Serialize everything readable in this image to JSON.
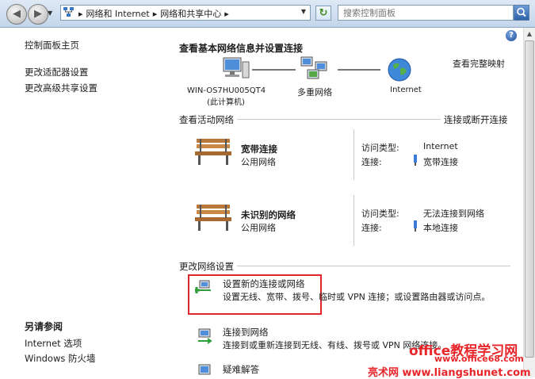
{
  "address_bar": {
    "crumbs": [
      "网络和 Internet",
      "网络和共享中心"
    ],
    "search_placeholder": "搜索控制面板"
  },
  "sidebar": {
    "items": [
      {
        "label": "控制面板主页"
      },
      {
        "label": "更改适配器设置"
      },
      {
        "label": "更改高级共享设置"
      }
    ],
    "see_also_title": "另请参阅",
    "see_also_items": [
      {
        "label": "Internet 选项"
      },
      {
        "label": "Windows 防火墙"
      }
    ]
  },
  "main": {
    "heading": "查看基本网络信息并设置连接",
    "full_map_link": "查看完整映射",
    "map_nodes": [
      {
        "label": "WIN-OS7HU005QT4",
        "sub": "(此计算机)"
      },
      {
        "label": "多重网络"
      },
      {
        "label": "Internet"
      }
    ],
    "active_section": {
      "title": "查看活动网络",
      "action": "连接或断开连接"
    },
    "networks": [
      {
        "name": "宽带连接",
        "category": "公用网络",
        "access_label": "访问类型:",
        "access_value": "Internet",
        "conn_label": "连接:",
        "conn_value": "宽带连接"
      },
      {
        "name": "未识别的网络",
        "category": "公用网络",
        "access_label": "访问类型:",
        "access_value": "无法连接到网络",
        "conn_label": "连接:",
        "conn_value": "本地连接"
      }
    ],
    "change_section": {
      "title": "更改网络设置"
    },
    "tasks": [
      {
        "title": "设置新的连接或网络",
        "desc": "设置无线、宽带、拨号、临时或 VPN 连接；或设置路由器或访问点。"
      },
      {
        "title": "连接到网络",
        "desc": "连接到或重新连接到无线、有线、拨号或 VPN 网络连接。"
      },
      {
        "title": "疑难解答"
      }
    ]
  },
  "watermarks": {
    "top": "office教程学习网",
    "middle": "www.office68.com",
    "bottom": "亮术网 www.liangshunet.com"
  },
  "colors": {
    "highlight_border": "#e0262a",
    "watermark": "#e8262a",
    "titlebar": "#c3d5ea"
  }
}
